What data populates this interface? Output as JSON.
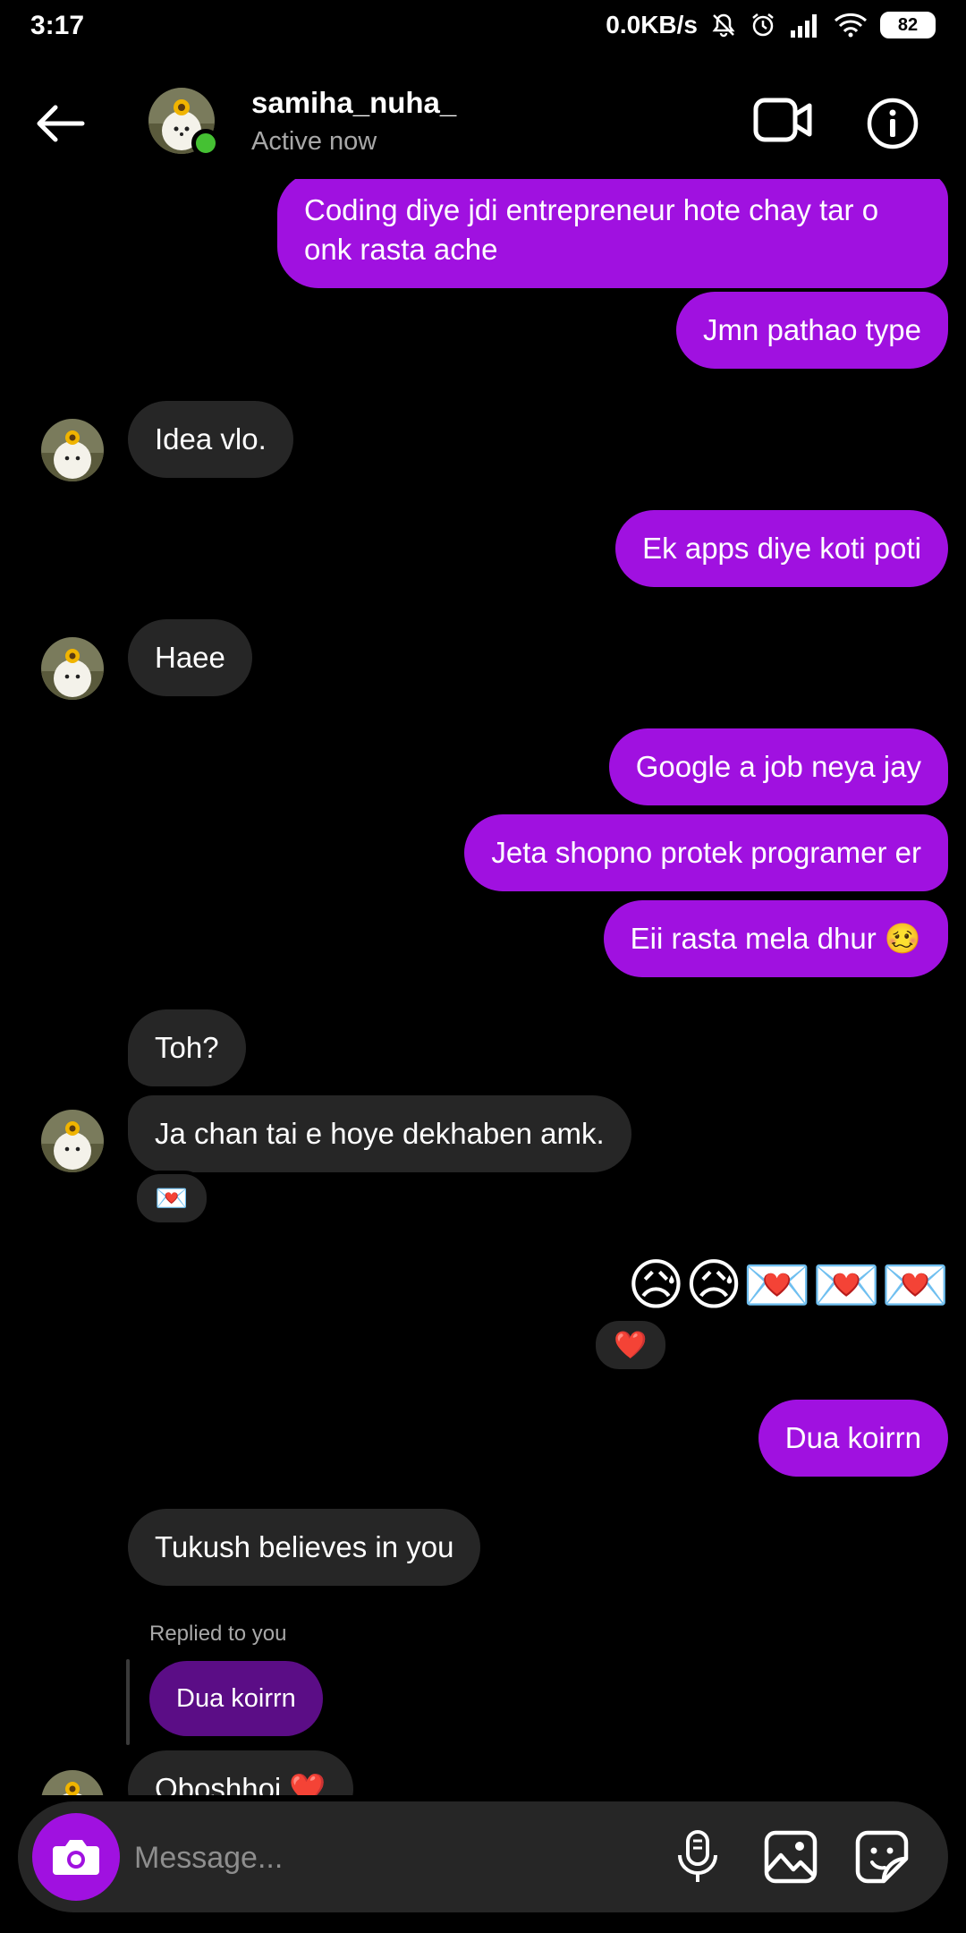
{
  "status_bar": {
    "time": "3:17",
    "network_speed": "0.0KB/s",
    "battery": "82",
    "icons": [
      "mute-icon",
      "alarm-icon",
      "signal-icon",
      "wifi-icon",
      "battery-icon"
    ]
  },
  "header": {
    "username": "samiha_nuha_",
    "status": "Active now",
    "icons": [
      "back-arrow-icon",
      "video-call-icon",
      "info-icon"
    ]
  },
  "messages": {
    "m1": "Coding diye jdi entrepreneur hote chay tar o onk rasta ache",
    "m2": "Jmn pathao type",
    "m3": "Idea vlo.",
    "m4": "Ek apps diye koti poti",
    "m5": "Haee",
    "m6": "Google a job neya jay",
    "m7": "Jeta shopno protek programer er",
    "m8": "Eii rasta mela dhur 🥴",
    "m9": "Toh?",
    "m10": "Ja chan tai e hoye dekhaben amk.",
    "m10_reaction": "💌",
    "m11_emojis": "😥😥💌💌💌",
    "m11_reaction": "❤️",
    "m12": "Dua koirrn",
    "m13": "Tukush believes in you",
    "reply_label": "Replied to you",
    "reply_quote": "Dua koirrn",
    "m14": "Oboshhoi ❤️"
  },
  "composer": {
    "placeholder": "Message...",
    "icons": [
      "camera-icon",
      "microphone-icon",
      "gallery-icon",
      "sticker-icon"
    ]
  },
  "colors": {
    "outgoing_bubble": "#a011e0",
    "incoming_bubble": "#262626",
    "reply_bubble": "#5b0d86",
    "online": "#45c133",
    "background": "#000000"
  }
}
